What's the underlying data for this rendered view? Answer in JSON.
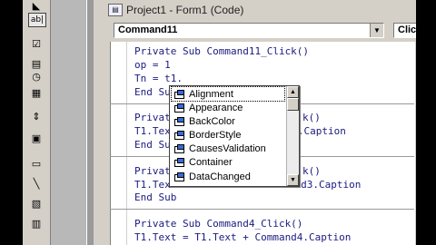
{
  "window": {
    "title": "Project1 - Form1 (Code)",
    "icon": "code-window-icon"
  },
  "combos": {
    "object": "Command11",
    "procedure": "Click"
  },
  "code_lines": [
    "Private Sub Command11_Click()",
    "op = 1",
    "Tn = t1.",
    "End Sub",
    "Private Sub Command2_Click()",
    "T1.Text = T1.Text + Command2.Caption",
    "End Sub",
    "Private Sub Command3_Click()",
    "T1.Text = T1.Text + Command3.Caption",
    "End Sub",
    "Private Sub Command4_Click()",
    "T1.Text = T1.Text + Command4.Caption"
  ],
  "code_display": {
    "l0": "Private Sub Command11_Click()",
    "l1": "op = 1",
    "l2": "Tn = t1.",
    "l3": "End Su",
    "l4": "Privat",
    "l4b": "k()",
    "l5": "T1.Tex",
    "l5b": "nd2.Caption",
    "l6": "End Su",
    "l7": "Privat",
    "l7b": "k()",
    "l8": "T1.Tex",
    "l8b": "ommand3.Caption",
    "l9": "End Sub",
    "l10": "Private Sub Command4_Click()",
    "l11": "T1.Text = T1.Text + Command4.Caption"
  },
  "intellisense": {
    "items": [
      "Alignment",
      "Appearance",
      "BackColor",
      "BorderStyle",
      "CausesValidation",
      "Container",
      "DataChanged"
    ],
    "selected": "Alignment",
    "icon": "property-icon"
  },
  "toolbox": {
    "tools": [
      "pointer-tool",
      "label-tool",
      "frame-tool",
      "checkbox-tool",
      "combobox-tool",
      "timer-tool",
      "listbox-tool",
      "scrollbar-tool",
      "picture-tool",
      "line-tool",
      "data-tool"
    ]
  }
}
